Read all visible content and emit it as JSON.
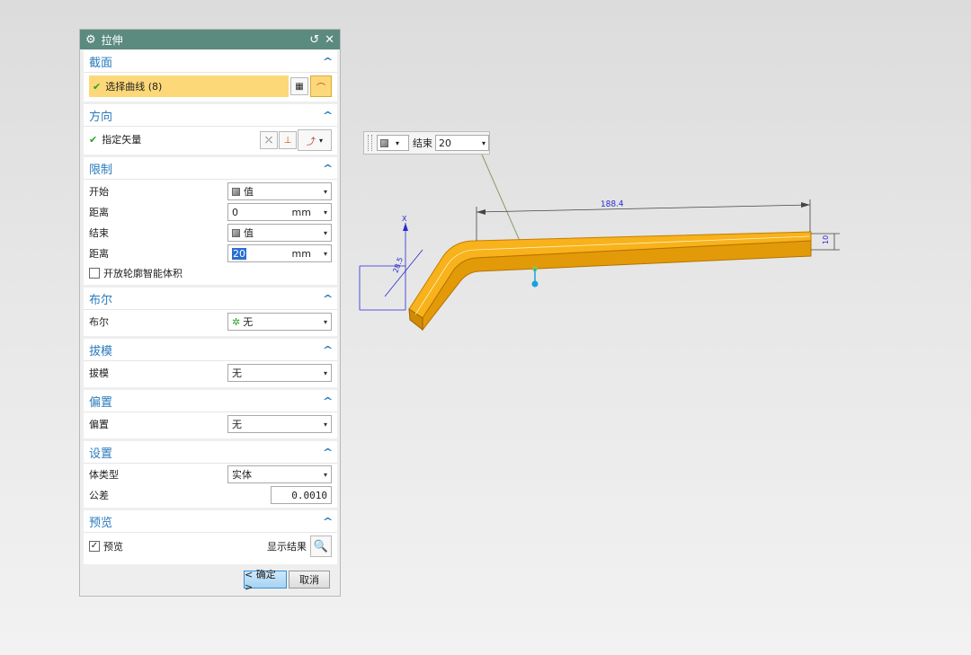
{
  "dialog": {
    "title": "拉伸",
    "sections": {
      "section": {
        "title": "截面",
        "select_curve": "选择曲线 (8)"
      },
      "direction": {
        "title": "方向",
        "specify_vector": "指定矢量"
      },
      "limits": {
        "title": "限制",
        "start_label": "开始",
        "start_value": "值",
        "dist1_label": "距离",
        "dist1_value": "0",
        "dist1_unit": "mm",
        "end_label": "结束",
        "end_value": "值",
        "dist2_label": "距离",
        "dist2_value": "20",
        "dist2_unit": "mm",
        "open_profile": "开放轮廓智能体积"
      },
      "boolean": {
        "title": "布尔",
        "label": "布尔",
        "value": "无"
      },
      "draft": {
        "title": "拔模",
        "label": "拔模",
        "value": "无"
      },
      "offset": {
        "title": "偏置",
        "label": "偏置",
        "value": "无"
      },
      "settings": {
        "title": "设置",
        "body_type_label": "体类型",
        "body_type_value": "实体",
        "tolerance_label": "公差",
        "tolerance_value": "0.0010"
      },
      "preview": {
        "title": "预览",
        "preview_label": "预览",
        "show_result": "显示结果"
      }
    },
    "ok_label": "< 确定 >",
    "cancel_label": "取消"
  },
  "float_toolbar": {
    "end_label": "结束",
    "end_value": "20"
  },
  "viewport": {
    "dim_length": "188.4",
    "dim_height": "10",
    "dim_angle": "28.5",
    "axis_x": "X",
    "part_color": "#f5a912"
  },
  "icons": {
    "gear": "gear-icon",
    "reset": "reset-icon",
    "close": "close-icon",
    "collapse": "chevron-up-icon",
    "check": "check-icon",
    "cube": "cube-icon",
    "magnifier": "magnifier-icon"
  },
  "colors": {
    "title_bar": "#5b8a7e",
    "section_title": "#2a7bbd",
    "highlight_row": "#fcd878",
    "primary_button": "#a7d3f4"
  }
}
